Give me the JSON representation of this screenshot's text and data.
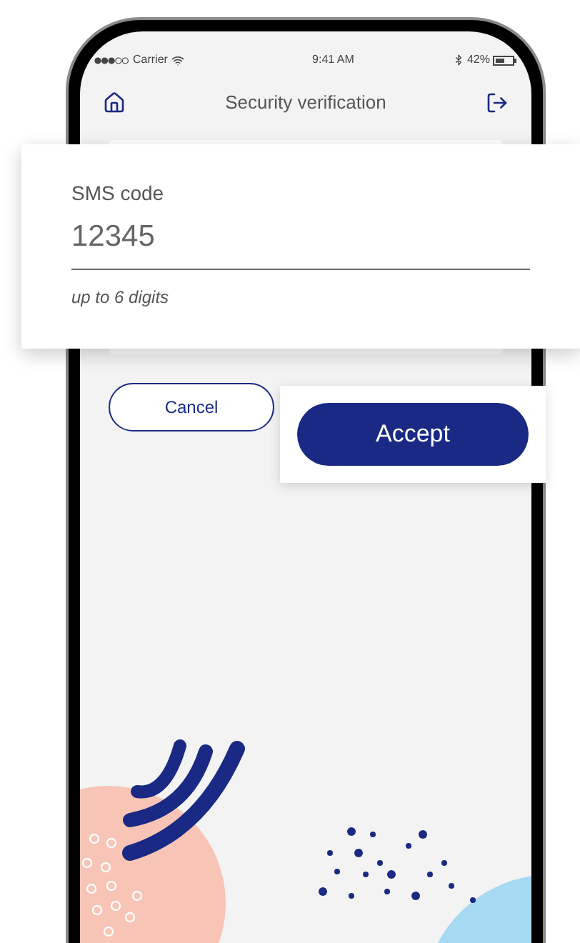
{
  "status_bar": {
    "carrier": "Carrier",
    "time": "9:41 AM",
    "battery": "42%"
  },
  "header": {
    "title": "Security verification"
  },
  "sms_field": {
    "label": "SMS code",
    "value": "12345",
    "hint": "up to 6 digits"
  },
  "buttons": [
    {
      "label": "Cancel",
      "kind": "secondary"
    },
    {
      "label": "Accept",
      "kind": "primary"
    }
  ]
}
